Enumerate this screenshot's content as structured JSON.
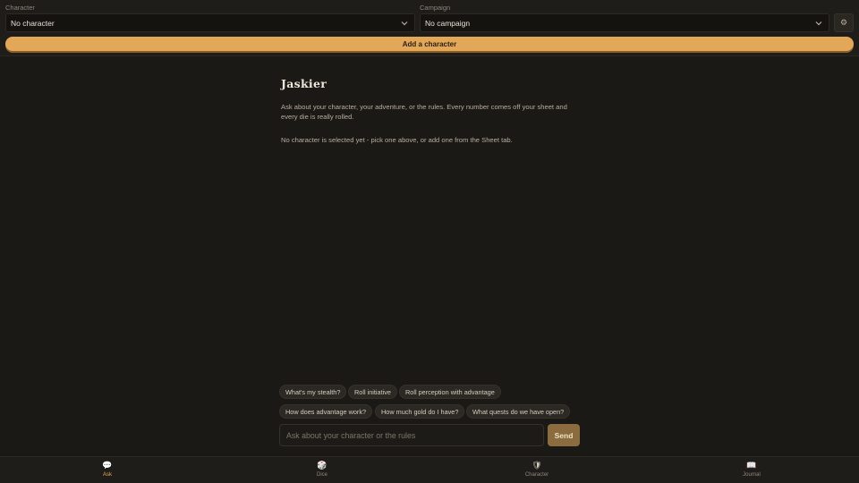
{
  "filters": {
    "character_label": "Character",
    "character_value": "No character",
    "campaign_label": "Campaign",
    "campaign_value": "No campaign",
    "settings_icon": "gear-icon"
  },
  "add_character_label": "Add a character",
  "main": {
    "title": "Jaskier",
    "intro": "Ask about your character, your adventure, or the rules. Every number comes off your sheet and every die is really rolled.",
    "notice": "No character is selected yet - pick one above, or add one from the Sheet tab."
  },
  "suggestions": [
    "What's my stealth?",
    "Roll initiative",
    "Roll perception with advantage",
    "How does advantage work?",
    "How much gold do I have?",
    "What quests do we have open?"
  ],
  "composer": {
    "placeholder": "Ask about your character or the rules",
    "send_label": "Send"
  },
  "nav": [
    {
      "label": "Ask",
      "icon": "speech-bubble-icon",
      "glyph": "💬",
      "active": true
    },
    {
      "label": "Dice",
      "icon": "dice-icon",
      "glyph": "🎲",
      "active": false
    },
    {
      "label": "Character",
      "icon": "shield-icon",
      "glyph": "🛡",
      "active": false
    },
    {
      "label": "Journal",
      "icon": "book-icon",
      "glyph": "📖",
      "active": false
    }
  ],
  "colors": {
    "accent": "#e3a857",
    "background": "#1b1915",
    "send": "#8a6c3e"
  }
}
